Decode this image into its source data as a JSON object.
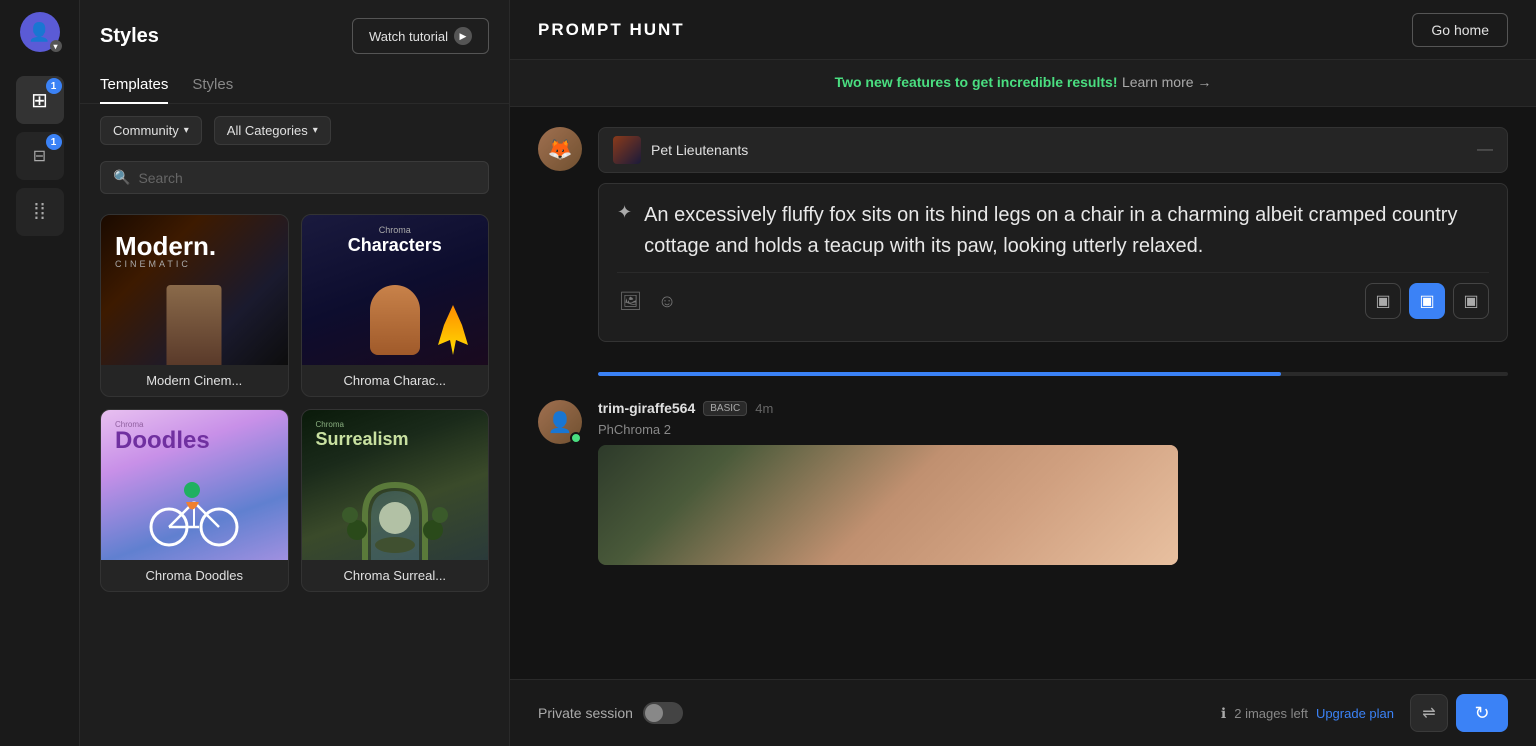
{
  "sidebar": {
    "items": [
      {
        "label": "avatar",
        "icon": "👤",
        "badge": null
      },
      {
        "label": "layers",
        "icon": "⊞",
        "badge": "1"
      },
      {
        "label": "grid",
        "icon": "⊟",
        "badge": "1"
      },
      {
        "label": "people",
        "icon": "⁞",
        "badge": null
      }
    ]
  },
  "panel": {
    "title": "Styles",
    "watch_tutorial_label": "Watch tutorial",
    "tabs": [
      {
        "label": "Templates",
        "active": true
      },
      {
        "label": "Styles",
        "active": false
      }
    ],
    "filters": {
      "community_label": "Community",
      "categories_label": "All Categories"
    },
    "search_placeholder": "Search",
    "templates": [
      {
        "id": "modern-cinematic",
        "label": "Modern Cinem..."
      },
      {
        "id": "chroma-characters",
        "label": "Chroma Charac..."
      },
      {
        "id": "chroma-doodles",
        "label": "Chroma Doodles"
      },
      {
        "id": "chroma-surrealism",
        "label": "Chroma Surreal..."
      }
    ]
  },
  "topbar": {
    "brand": "PROMPT HUNT",
    "go_home_label": "Go home"
  },
  "banner": {
    "highlight_text": "Two new features to get incredible results!",
    "learn_more_text": "Learn more →"
  },
  "chat": {
    "messages": [
      {
        "id": "msg1",
        "style_name": "Pet Lieutenants",
        "prompt_text": "An excessively fluffy fox sits on its hind legs on a chair in a charming albeit cramped country cottage and holds a teacup with its paw, looking utterly relaxed."
      }
    ],
    "private_session_label": "Private session",
    "images_left_label": "2 images left",
    "upgrade_label": "Upgrade plan",
    "second_message": {
      "username": "trim-giraffe564",
      "badge": "BASIC",
      "time": "4m",
      "style": "PhChroma 2"
    }
  },
  "icons": {
    "play": "▶",
    "chevron_down": "▾",
    "search": "🔍",
    "sparkle": "✦",
    "image": "🖼",
    "emoji": "☺",
    "shuffle": "⇌",
    "refresh": "↻",
    "small_image": "▣"
  }
}
